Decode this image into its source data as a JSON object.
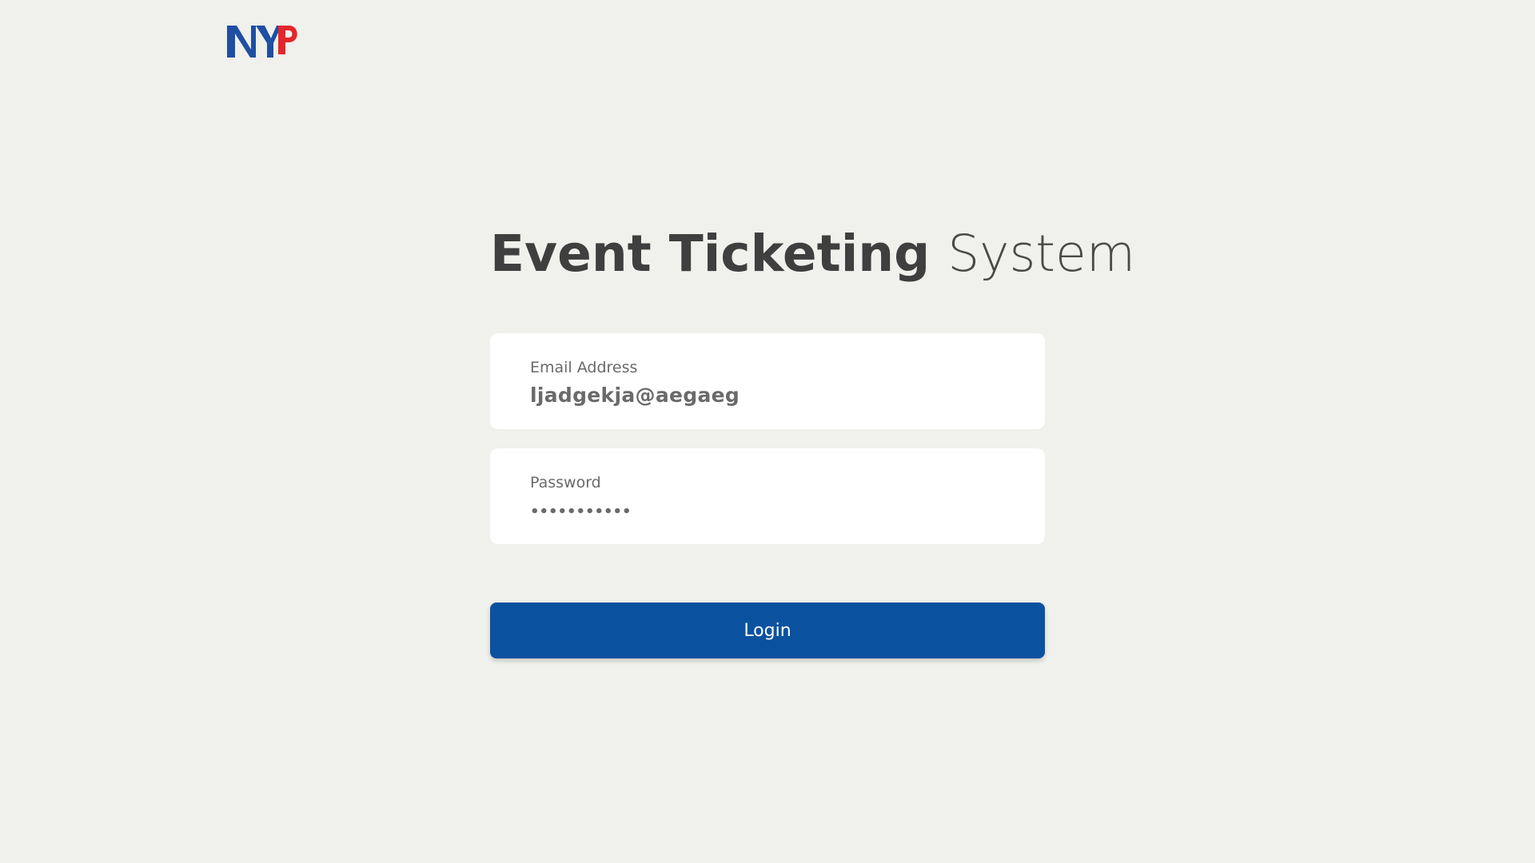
{
  "logo": {
    "text": "NYP",
    "colors": {
      "primary": "#1f4fa3",
      "accent": "#e3262d"
    }
  },
  "title": {
    "bold": "Event Ticketing",
    "light": "System"
  },
  "email": {
    "label": "Email Address",
    "value": "ljadgekja@aegaeg"
  },
  "password": {
    "label": "Password",
    "masked_value": "•••••••••••"
  },
  "login": {
    "label": "Login",
    "color": "#0a52a0"
  },
  "colors": {
    "background": "#f0f0ec",
    "card": "#ffffff",
    "title_text": "#3f3f3f",
    "field_text": "#6a6a6a"
  }
}
